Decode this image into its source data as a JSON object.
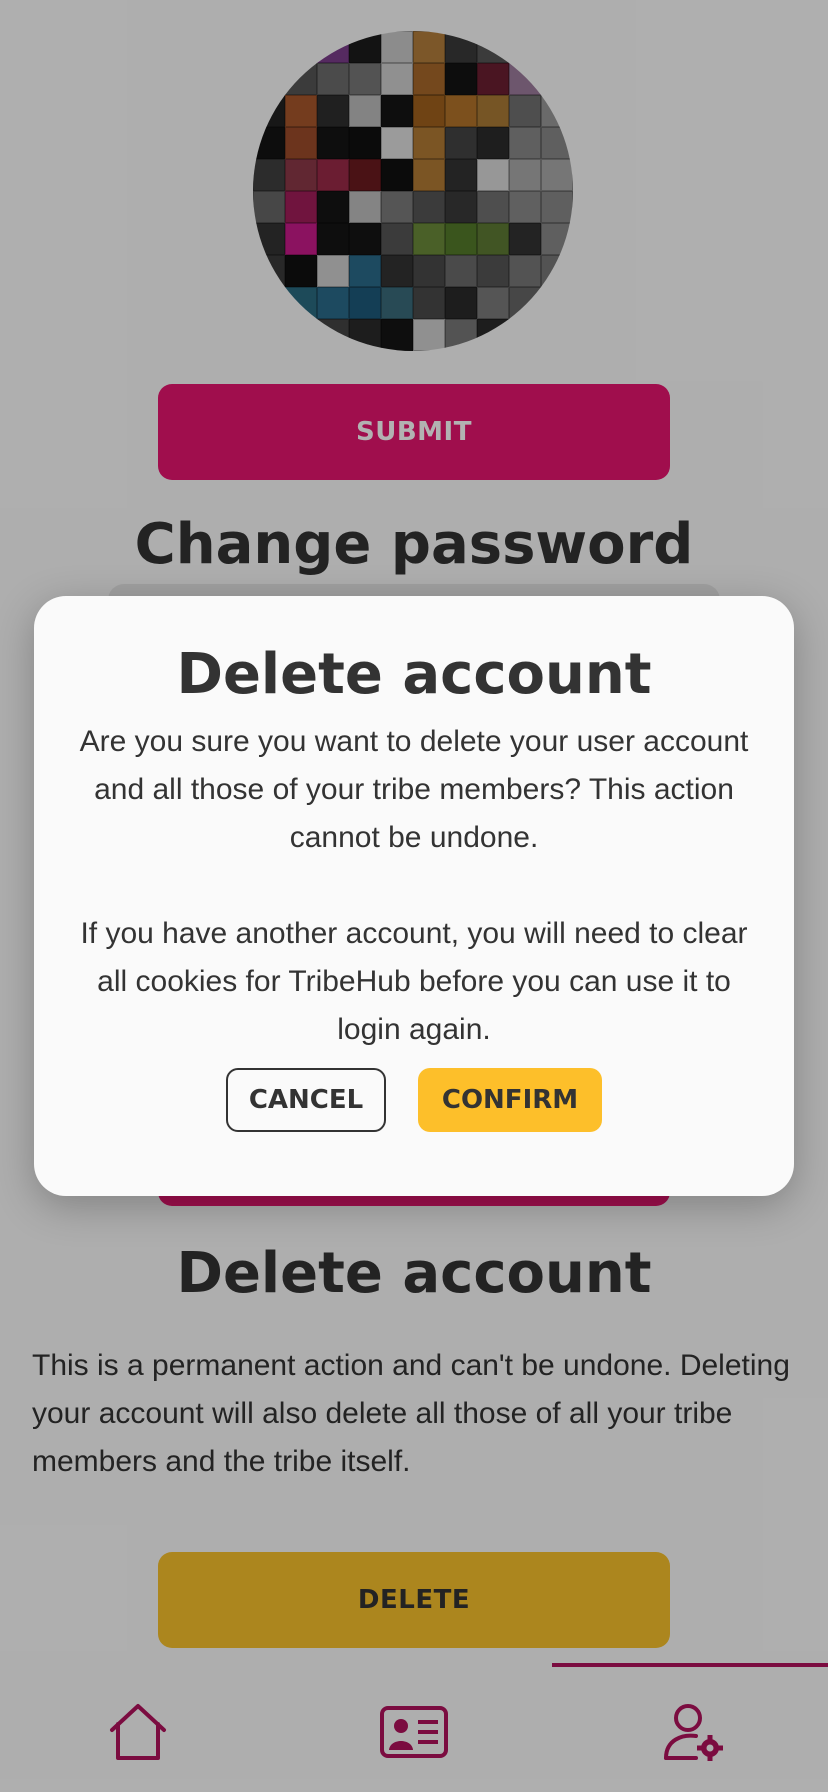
{
  "profile": {
    "avatar_alt": "user avatar",
    "avatar_colors": [
      [
        "#2b2b2b",
        "#3b3b3b",
        "#7a3d8a",
        "#1c1c1c",
        "#c9c9c9",
        "#b27d3b",
        "#3a3a3a",
        "#555555",
        "#777777",
        "#aaaaaa"
      ],
      [
        "#2a2a2a",
        "#555555",
        "#6c6c6c",
        "#777777",
        "#cfcfcf",
        "#a6682a",
        "#141414",
        "#6b1f31",
        "#9c7b9c",
        "#aaaaaa"
      ],
      [
        "#222222",
        "#a7572c",
        "#2f2f2f",
        "#bcbcbc",
        "#151515",
        "#a0601d",
        "#b2732a",
        "#aa7a35",
        "#707070",
        "#999999"
      ],
      [
        "#141414",
        "#9b4b2a",
        "#151515",
        "#111111",
        "#dfdfdf",
        "#b17a34",
        "#444444",
        "#2b2b2b",
        "#888888",
        "#888888"
      ],
      [
        "#404040",
        "#8c3848",
        "#9a2a48",
        "#6b1a1f",
        "#111111",
        "#b17a34",
        "#333333",
        "#d8d8d8",
        "#aaaaaa",
        "#aaaaaa"
      ],
      [
        "#666666",
        "#a11e5a",
        "#151515",
        "#bdbdbd",
        "#7a7a7a",
        "#555555",
        "#3a3a3a",
        "#707070",
        "#8a8a8a",
        "#888888"
      ],
      [
        "#333333",
        "#c81a8a",
        "#151515",
        "#151515",
        "#555555",
        "#6a8a3a",
        "#537a2a",
        "#5e7a34",
        "#333333",
        "#888888"
      ],
      [
        "#3a3a3a",
        "#111111",
        "#cfcfcf",
        "#2a6a8a",
        "#333333",
        "#4a4a4a",
        "#6a6a6a",
        "#555555",
        "#777777",
        "#777777"
      ],
      [
        "#2a2a2a",
        "#2a6a80",
        "#2a6a8a",
        "#1e5a7a",
        "#3a6a7a",
        "#4a4a4a",
        "#2a2a2a",
        "#7a7a7a",
        "#666666",
        "#444444"
      ],
      [
        "#222222",
        "#111111",
        "#444444",
        "#2a2a2a",
        "#151515",
        "#cfcfcf",
        "#777777",
        "#2a2a2a",
        "#444444",
        "#222222"
      ]
    ],
    "submit_label": "SUBMIT"
  },
  "change_password": {
    "title": "Change password"
  },
  "delete_section": {
    "title": "Delete account",
    "description": "This is a permanent action and can't be undone. Deleting your account will also delete all those of all your tribe members and the tribe itself.",
    "button_label": "DELETE"
  },
  "modal": {
    "title": "Delete account",
    "message_1": "Are you sure you want to delete your user account and all those of your tribe members? This action cannot be undone.",
    "message_2": "If you have another account, you will need to clear all cookies for TribeHub before you can use it to login again.",
    "cancel_label": "CANCEL",
    "confirm_label": "CONFIRM"
  },
  "nav": {
    "items": [
      {
        "icon": "home-icon"
      },
      {
        "icon": "id-card-icon"
      },
      {
        "icon": "user-settings-icon",
        "active": true
      }
    ],
    "accent": "#b0125c"
  },
  "colors": {
    "primary": "#e6156f",
    "warning": "#fdbf2a",
    "text": "#333333"
  }
}
